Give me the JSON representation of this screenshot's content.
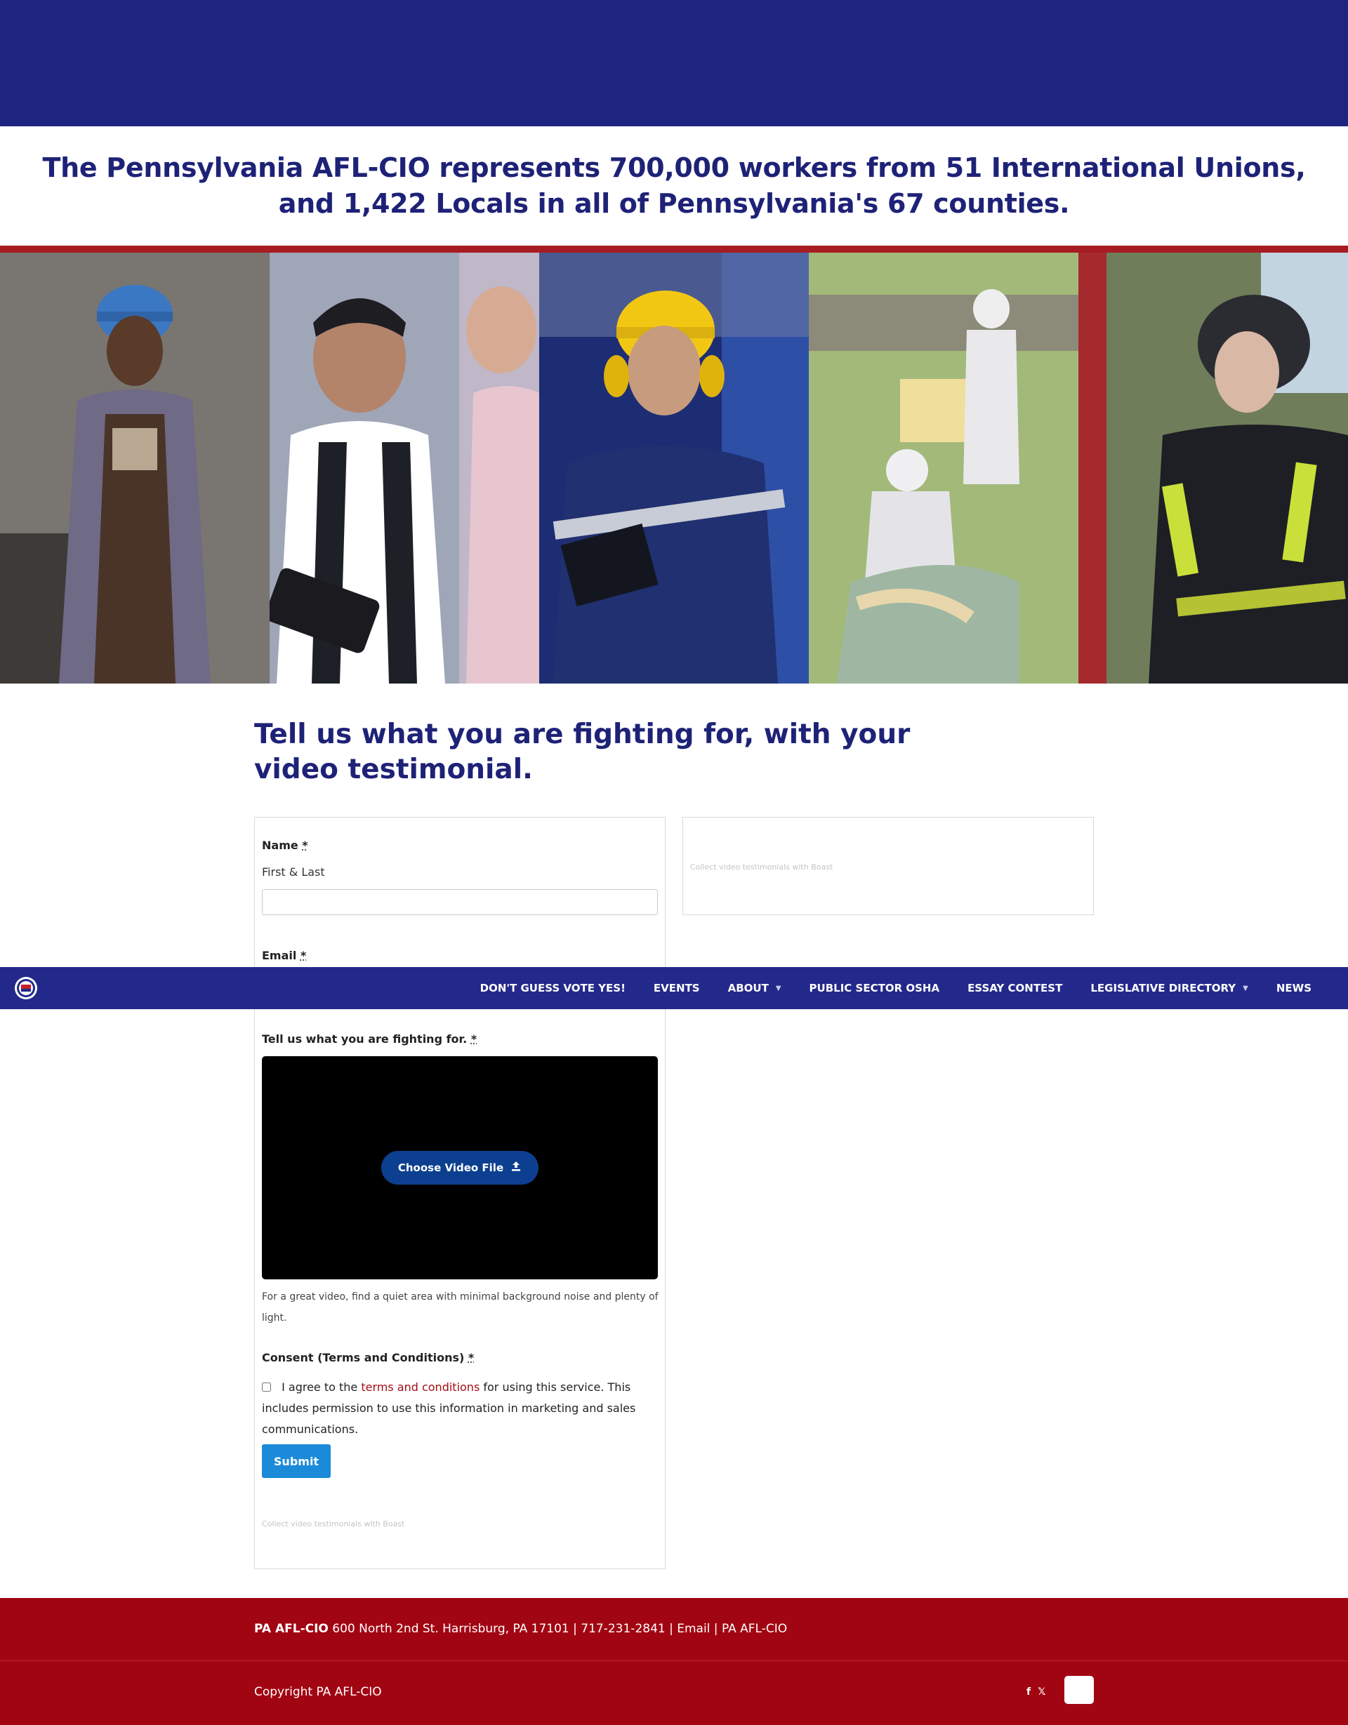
{
  "colors": {
    "brand_navy": "#1e2580",
    "heading_navy": "#1e2277",
    "accent_red": "#a61c22",
    "footer_red": "#a20512",
    "submit_blue": "#1a8ad9",
    "video_button_blue": "#0c3f8f",
    "link_red": "#a30d12"
  },
  "headline": "The Pennsylvania AFL-CIO represents 700,000 workers from 51 International Unions, and 1,422 Locals in all of Pennsylvania's 67 counties.",
  "section_title": "Tell us what you are fighting for, with your video testimonial.",
  "form": {
    "name_label": "Name",
    "name_help": "First & Last",
    "name_value": "",
    "email_label": "Email",
    "fighting_label": "Tell us what you are fighting for.",
    "required_mark": "*",
    "video_button": "Choose Video File",
    "video_button_icon": "upload-icon",
    "video_hint": "For a great video, find a quiet area with minimal background noise and plenty of light.",
    "consent_label": "Consent (Terms and Conditions)",
    "consent_checked": false,
    "consent_before": "I agree to the",
    "consent_link": "terms and conditions",
    "consent_after": "for using this service. This includes permission to use this information in marketing and sales communications.",
    "submit": "Submit",
    "boast_note": "Collect video testimonials with Boast"
  },
  "widget": {
    "boast_note": "Collect video testimonials with Boast"
  },
  "nav": {
    "logo_icon": "aflcio-seal-icon",
    "items": [
      {
        "label": "DON'T GUESS VOTE YES!",
        "dropdown": false
      },
      {
        "label": "EVENTS",
        "dropdown": false
      },
      {
        "label": "ABOUT",
        "dropdown": true
      },
      {
        "label": "PUBLIC SECTOR OSHA",
        "dropdown": false
      },
      {
        "label": "ESSAY CONTEST",
        "dropdown": false
      },
      {
        "label": "LEGISLATIVE DIRECTORY",
        "dropdown": true
      },
      {
        "label": "NEWS",
        "dropdown": false
      }
    ],
    "caret": "▼"
  },
  "footer": {
    "org": "PA AFL-CIO",
    "address": "600 North 2nd St. Harrisburg, PA 17101 | 717-231-2841 | Email | PA AFL-CIO",
    "copyright": "Copyright PA AFL-CIO",
    "social_facebook": "f",
    "social_x": "𝕏"
  },
  "photos": [
    {
      "name": "worker-blue-hardhat-photo"
    },
    {
      "name": "workers-tablet-photo"
    },
    {
      "name": "worker-yellow-hardhat-photo"
    },
    {
      "name": "cleanroom-production-photo"
    },
    {
      "name": "firefighter-photo"
    }
  ]
}
